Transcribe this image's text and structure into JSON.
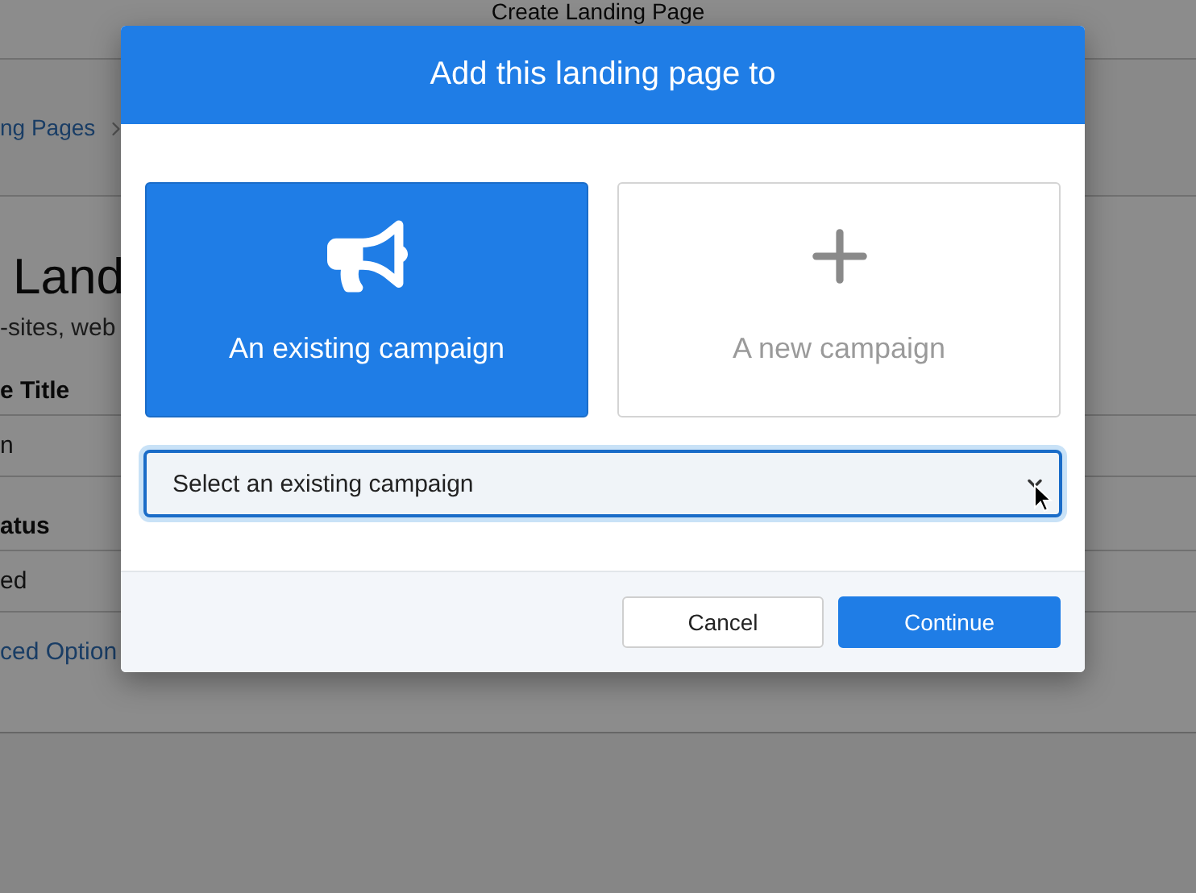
{
  "page": {
    "title": "Create Landing Page",
    "breadcrumb": [
      {
        "label": "ng Pages"
      }
    ],
    "heading": "Land",
    "description": "-sites, web",
    "fields": [
      {
        "label": "e Title",
        "value": "n"
      },
      {
        "label": "atus",
        "value": "ed"
      }
    ],
    "advanced_link": "ced Option"
  },
  "dialog": {
    "title": "Add this landing page to",
    "options": [
      {
        "kind": "existing",
        "label": "An existing campaign",
        "selected": true
      },
      {
        "kind": "new",
        "label": "A new campaign",
        "selected": false
      }
    ],
    "select": {
      "placeholder": "Select an existing campaign"
    },
    "buttons": [
      {
        "kind": "secondary",
        "label": "Cancel"
      },
      {
        "kind": "primary",
        "label": "Continue"
      }
    ]
  }
}
